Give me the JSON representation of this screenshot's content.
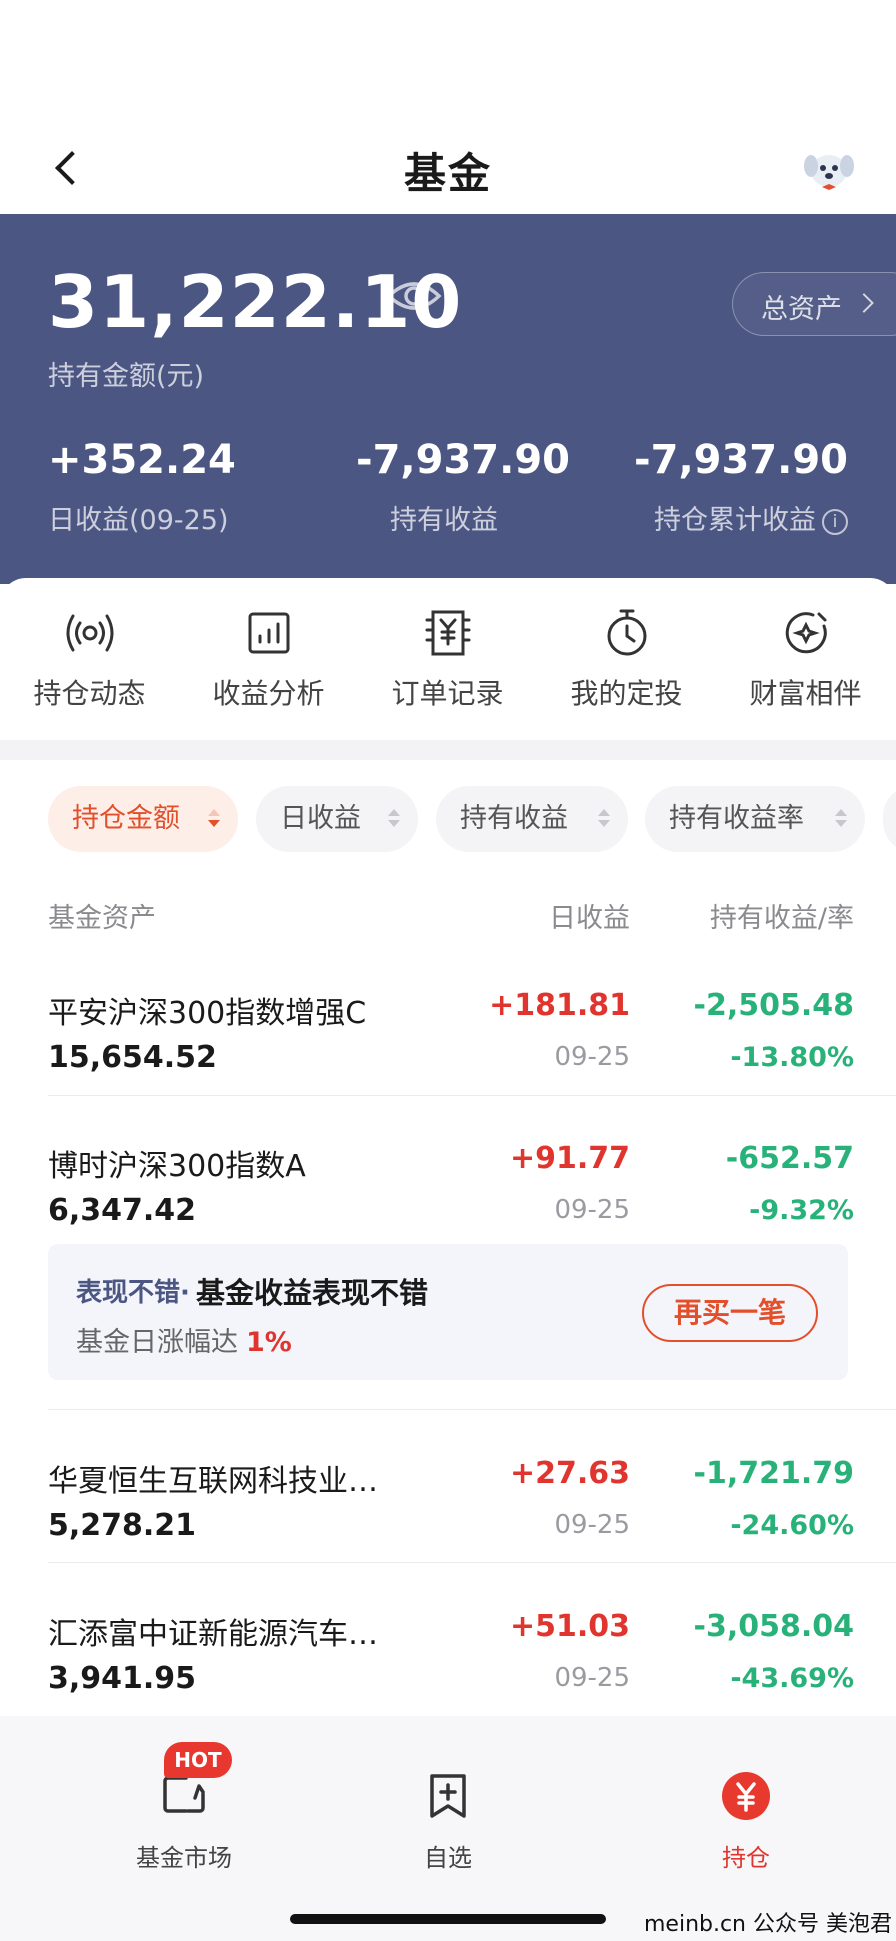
{
  "nav": {
    "title": "基金"
  },
  "summary": {
    "total_amount": "31,222.10",
    "total_label": "持有金额(元)",
    "assets_button": "总资产",
    "daily_value": "+352.24",
    "daily_label": "日收益(09-25)",
    "holding_value": "-7,937.90",
    "holding_label": "持有收益",
    "cumulative_value": "-7,937.90",
    "cumulative_label": "持仓累计收益",
    "info_glyph": "i"
  },
  "actions": [
    {
      "label": "持仓动态",
      "icon": "broadcast-icon"
    },
    {
      "label": "收益分析",
      "icon": "bar-chart-icon"
    },
    {
      "label": "订单记录",
      "icon": "yuan-receipt-icon"
    },
    {
      "label": "我的定投",
      "icon": "timer-icon"
    },
    {
      "label": "财富相伴",
      "icon": "compass-icon"
    }
  ],
  "sort_chips": [
    {
      "label": "持仓金额",
      "active": true
    },
    {
      "label": "日收益",
      "active": false
    },
    {
      "label": "持有收益",
      "active": false
    },
    {
      "label": "持有收益率",
      "active": false
    }
  ],
  "table": {
    "headers": {
      "asset": "基金资产",
      "daily": "日收益",
      "holding": "持有收益/率"
    },
    "rows": [
      {
        "name": "平安沪深300指数增强C",
        "amount": "15,654.52",
        "daily": "+181.81",
        "date": "09-25",
        "holding": "-2,505.48",
        "rate": "-13.80%"
      },
      {
        "name": "博时沪深300指数A",
        "amount": "6,347.42",
        "daily": "+91.77",
        "date": "09-25",
        "holding": "-652.57",
        "rate": "-9.32%"
      },
      {
        "name": "华夏恒生互联网科技业…",
        "amount": "5,278.21",
        "daily": "+27.63",
        "date": "09-25",
        "holding": "-1,721.79",
        "rate": "-24.60%"
      },
      {
        "name": "汇添富中证新能源汽车…",
        "amount": "3,941.95",
        "daily": "+51.03",
        "date": "09-25",
        "holding": "-3,058.04",
        "rate": "-43.69%"
      }
    ]
  },
  "promo": {
    "tag": "表现不错·",
    "title": "基金收益表现不错",
    "subtitle": "基金日涨幅达",
    "highlight": "1%",
    "button": "再买一笔"
  },
  "tabbar": [
    {
      "label": "基金市场",
      "badge": "HOT",
      "icon": "market-icon",
      "active": false
    },
    {
      "label": "自选",
      "icon": "bookmark-plus-icon",
      "active": false
    },
    {
      "label": "持仓",
      "icon": "yuan-circle-icon",
      "active": true
    }
  ],
  "watermark": "meinb.cn 公众号 美泡君",
  "colors": {
    "header_bg": "#4b5683",
    "accent": "#e24f2a",
    "gain": "#e0352e",
    "loss": "#28b27a"
  }
}
